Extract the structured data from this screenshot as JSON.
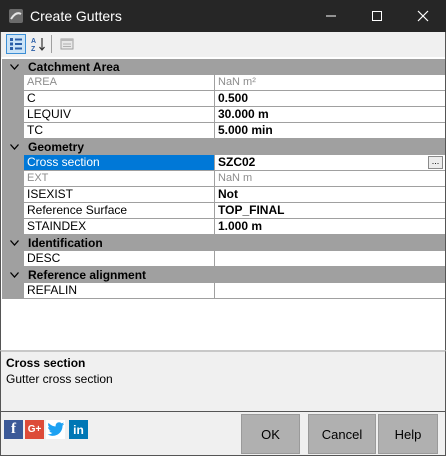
{
  "window": {
    "title": "Create Gutters",
    "icon": "app-icon",
    "controls": [
      "minimize-icon",
      "maximize-icon",
      "close-icon"
    ]
  },
  "toolbar": {
    "buttons": [
      {
        "name": "categorized-view",
        "icon": "categorized-icon",
        "active": true
      },
      {
        "name": "alphabetical-sort",
        "icon": "sort-az-icon",
        "active": false
      },
      {
        "name": "property-pages",
        "icon": "property-pages-icon",
        "active": false
      }
    ]
  },
  "categories": [
    {
      "label": "Catchment Area",
      "rows": [
        {
          "name": "AREA",
          "value": "NaN m²",
          "disabled": true
        },
        {
          "name": "C",
          "value": "0.500"
        },
        {
          "name": "LEQUIV",
          "value": "30.000 m"
        },
        {
          "name": "TC",
          "value": "5.000 min"
        }
      ]
    },
    {
      "label": "Geometry",
      "rows": [
        {
          "name": "Cross section",
          "value": "SZC02",
          "selected": true,
          "button": "..."
        },
        {
          "name": "EXT",
          "value": "NaN m",
          "disabled": true
        },
        {
          "name": "ISEXIST",
          "value": "Not"
        },
        {
          "name": "Reference Surface",
          "value": "TOP_FINAL"
        },
        {
          "name": "STAINDEX",
          "value": "1.000 m"
        }
      ]
    },
    {
      "label": "Identification",
      "rows": [
        {
          "name": "DESC",
          "value": ""
        }
      ]
    },
    {
      "label": "Reference alignment",
      "rows": [
        {
          "name": "REFALIN",
          "value": ""
        }
      ]
    }
  ],
  "description": {
    "title": "Cross section",
    "text": "Gutter cross section"
  },
  "social": [
    {
      "name": "facebook-icon",
      "glyph": "f",
      "color": "#3b5998"
    },
    {
      "name": "google-plus-icon",
      "glyph": "G+",
      "color": "#dd4b39"
    },
    {
      "name": "twitter-icon",
      "glyph": "",
      "color": "#1da1f2"
    },
    {
      "name": "linkedin-icon",
      "glyph": "in",
      "color": "#0077b5"
    }
  ],
  "buttons": {
    "ok": "OK",
    "cancel": "Cancel",
    "help": "Help"
  }
}
